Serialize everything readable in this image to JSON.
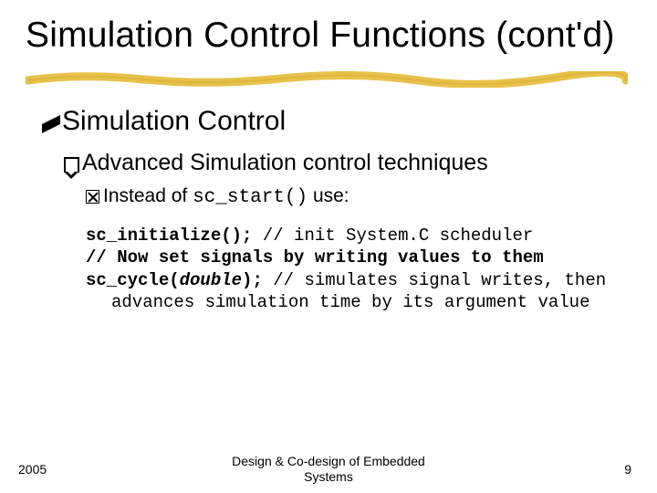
{
  "title": "Simulation Control Functions (cont'd)",
  "bullets": {
    "l1": "Simulation Control",
    "l2": "Advanced Simulation control techniques",
    "l3_pre": "Instead of ",
    "l3_code": "sc_start()",
    "l3_post": " use:"
  },
  "code": {
    "line1_b": "sc_initialize();",
    "line1_rest": " // init System.C scheduler",
    "line2": "// Now set signals by writing values to them",
    "line3_a": "sc_cycle(",
    "line3_b": "double",
    "line3_c": ");",
    "line3_rest": " // simulates signal writes, then",
    "line4": "advances simulation time by its argument value"
  },
  "footer": {
    "left": "2005",
    "center_l1": "Design & Co-design of Embedded",
    "center_l2": "Systems",
    "right": "9"
  }
}
